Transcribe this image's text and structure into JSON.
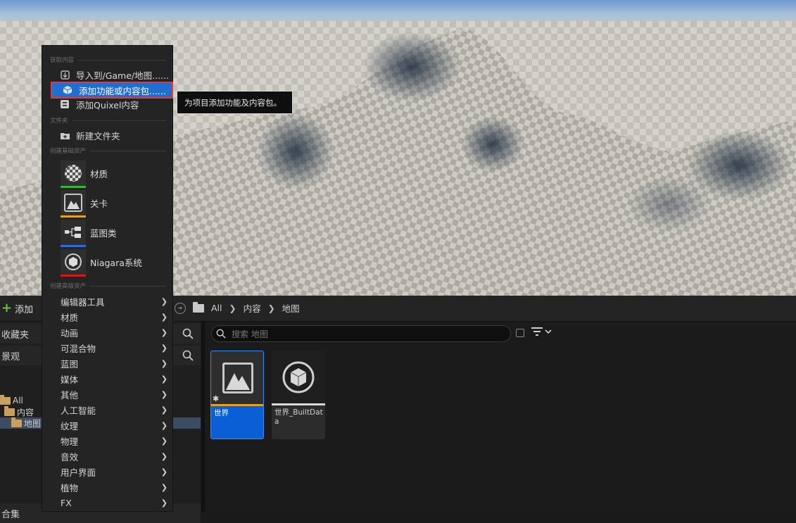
{
  "menu": {
    "sections": {
      "get_content": "获取内容",
      "folder": "文件夹",
      "basic_assets": "创建基础资产",
      "advanced_assets": "创建高级资产"
    },
    "items": {
      "import": "导入到/Game/地图......",
      "add_feature": "添加功能或内容包......",
      "add_quixel": "添加Quixel内容",
      "new_folder": "新建文件夹"
    },
    "basic": [
      {
        "label": "材质",
        "color": "#3cb043"
      },
      {
        "label": "关卡",
        "color": "#e6a020"
      },
      {
        "label": "蓝图类",
        "color": "#2f6ed8"
      },
      {
        "label": "Niagara系统",
        "color": "#d11a1a"
      }
    ],
    "advanced": [
      "编辑器工具",
      "材质",
      "动画",
      "可混合物",
      "蓝图",
      "媒体",
      "其他",
      "人工智能",
      "纹理",
      "物理",
      "音效",
      "用户界面",
      "植物",
      "FX"
    ]
  },
  "tooltip": "为项目添加功能及内容包。",
  "toolbar": {
    "add_label": "添加",
    "breadcrumb": [
      "All",
      "内容",
      "地图"
    ]
  },
  "left_panel": {
    "favorites": "收藏夹",
    "project": "景观",
    "tree": [
      "All",
      "内容",
      "地图"
    ],
    "collections": "合集"
  },
  "search": {
    "placeholder": "搜索 地图"
  },
  "assets": [
    {
      "name": "世界",
      "bar_color": "#e6a020",
      "selected": true
    },
    {
      "name": "世界_BuiltData",
      "bar_color": "#d9d9d9",
      "selected": false
    }
  ]
}
